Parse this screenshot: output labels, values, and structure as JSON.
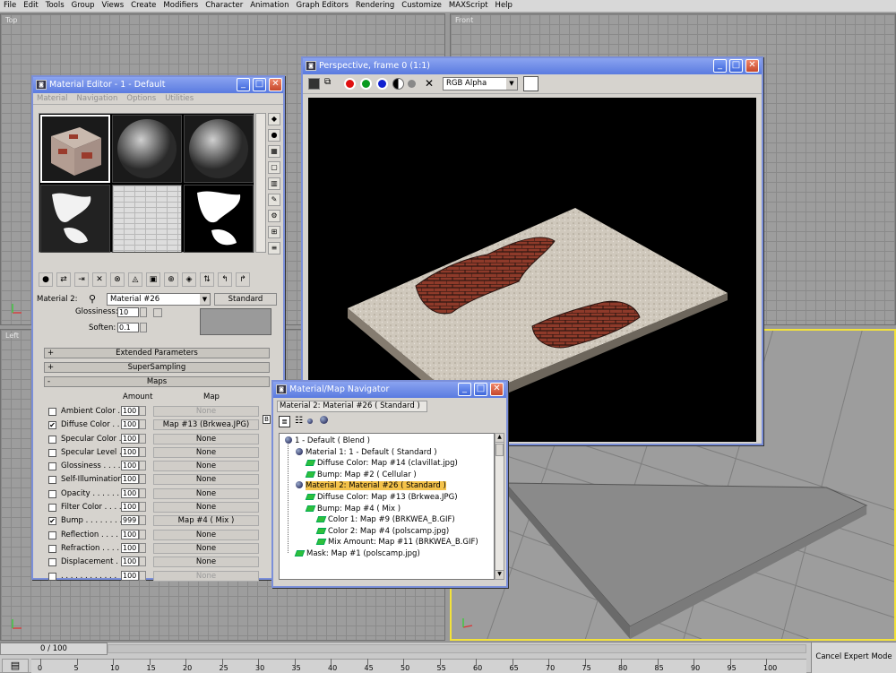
{
  "menu": [
    "File",
    "Edit",
    "Tools",
    "Group",
    "Views",
    "Create",
    "Modifiers",
    "Character",
    "Animation",
    "Graph Editors",
    "Rendering",
    "Customize",
    "MAXScript",
    "Help"
  ],
  "viewports": {
    "top": "Top",
    "front": "Front",
    "left": "Left"
  },
  "timeline": {
    "frame": "0 / 100",
    "ticks": [
      "0",
      "5",
      "10",
      "15",
      "20",
      "25",
      "30",
      "35",
      "40",
      "45",
      "50",
      "55",
      "60",
      "65",
      "70",
      "75",
      "80",
      "85",
      "90",
      "95",
      "100"
    ],
    "cancel_expert": "Cancel Expert Mode"
  },
  "mat_editor": {
    "title": "Material Editor - 1 - Default",
    "menus": [
      "Material",
      "Navigation",
      "Options",
      "Utilities"
    ],
    "slot_label": "Material 2:",
    "material_name": "Material #26",
    "type_button": "Standard",
    "glossiness_label": "Glossiness:",
    "glossiness_value": "10",
    "soften_label": "Soften:",
    "soften_value": "0.1",
    "rollouts": [
      "Extended Parameters",
      "SuperSampling",
      "Maps"
    ],
    "rollout_signs": [
      "+",
      "+",
      "-"
    ],
    "maps_header": {
      "amount": "Amount",
      "map": "Map"
    },
    "maps": [
      {
        "checked": "",
        "label": "Ambient Color . . .",
        "amount": "100",
        "map": "None",
        "dim": true
      },
      {
        "checked": "✔",
        "label": "Diffuse Color . . .",
        "amount": "100",
        "map": "Map #13 (Brkwea.JPG)",
        "dim": false
      },
      {
        "checked": "",
        "label": "Specular Color . .",
        "amount": "100",
        "map": "None",
        "dim": false
      },
      {
        "checked": "",
        "label": "Specular Level . .",
        "amount": "100",
        "map": "None",
        "dim": false
      },
      {
        "checked": "",
        "label": "Glossiness . . . . .",
        "amount": "100",
        "map": "None",
        "dim": false
      },
      {
        "checked": "",
        "label": "Self-Illumination .",
        "amount": "100",
        "map": "None",
        "dim": false
      },
      {
        "checked": "",
        "label": "Opacity . . . . . . .",
        "amount": "100",
        "map": "None",
        "dim": false
      },
      {
        "checked": "",
        "label": "Filter Color . . . .",
        "amount": "100",
        "map": "None",
        "dim": false
      },
      {
        "checked": "✔",
        "label": "Bump . . . . . . . .",
        "amount": "999",
        "map": "Map #4  ( Mix )",
        "dim": false
      },
      {
        "checked": "",
        "label": "Reflection . . . . .",
        "amount": "100",
        "map": "None",
        "dim": false
      },
      {
        "checked": "",
        "label": "Refraction . . . . .",
        "amount": "100",
        "map": "None",
        "dim": false
      },
      {
        "checked": "",
        "label": "Displacement . . .",
        "amount": "100",
        "map": "None",
        "dim": false
      },
      {
        "checked": "",
        "label": ". . . . . . . . . . . .",
        "amount": "100",
        "map": "None",
        "dim": true
      }
    ]
  },
  "persp": {
    "title": "Perspective, frame 0 (1:1)",
    "channel": "RGB Alpha"
  },
  "navigator": {
    "title": "Material/Map Navigator",
    "path": "Material 2: Material #26  ( Standard )",
    "tree": [
      {
        "t": "1 - Default  ( Blend )",
        "lvl": 0,
        "icon": "sphere",
        "hl": false
      },
      {
        "t": "Material 1: 1 - Default  ( Standard )",
        "lvl": 1,
        "icon": "sphere",
        "hl": false
      },
      {
        "t": "Diffuse Color: Map #14 (clavillat.jpg)",
        "lvl": 2,
        "icon": "map",
        "hl": false
      },
      {
        "t": "Bump: Map #2  ( Cellular )",
        "lvl": 2,
        "icon": "map",
        "hl": false
      },
      {
        "t": "Material 2: Material #26  ( Standard )",
        "lvl": 1,
        "icon": "sphere",
        "hl": true
      },
      {
        "t": "Diffuse Color: Map #13 (Brkwea.JPG)",
        "lvl": 2,
        "icon": "map",
        "hl": false
      },
      {
        "t": "Bump: Map #4  ( Mix )",
        "lvl": 2,
        "icon": "map",
        "hl": false
      },
      {
        "t": "Color 1: Map #9 (BRKWEA_B.GIF)",
        "lvl": 3,
        "icon": "map",
        "hl": false
      },
      {
        "t": "Color 2: Map #4 (polscamp.jpg)",
        "lvl": 3,
        "icon": "map",
        "hl": false
      },
      {
        "t": "Mix Amount: Map #11 (BRKWEA_B.GIF)",
        "lvl": 3,
        "icon": "map",
        "hl": false
      },
      {
        "t": "Mask: Map #1 (polscamp.jpg)",
        "lvl": 1,
        "icon": "map",
        "hl": false
      }
    ]
  }
}
